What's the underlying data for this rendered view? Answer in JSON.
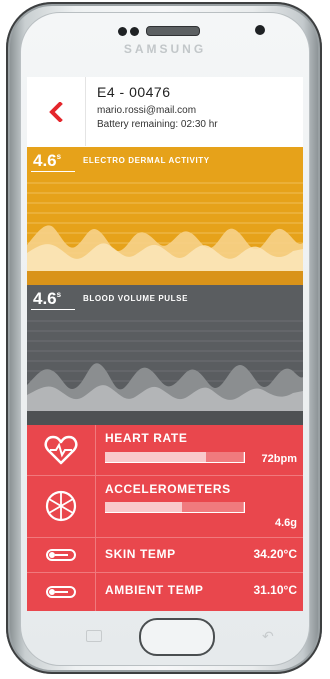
{
  "phone": {
    "brand": "SAMSUNG"
  },
  "header": {
    "device_id": "E4 - 00476",
    "email": "mario.rossi@mail.com",
    "battery": "Battery remaining: 02:30 hr"
  },
  "eda": {
    "value": "4.6",
    "unit": "s",
    "label": "ELECTRO DERMAL ACTIVITY",
    "color": "#e6a21a"
  },
  "bvp": {
    "value": "4.6",
    "unit": "s",
    "label": "BLOOD VOLUME PULSE",
    "color": "#5a5d60"
  },
  "metrics": {
    "heart_rate": {
      "title": "HEART RATE",
      "value": "72bpm",
      "level": 0.72
    },
    "accelerometers": {
      "title": "ACCELEROMETERS",
      "value": "4.6g",
      "level": 0.55
    },
    "skin_temp": {
      "title": "SKIN TEMP",
      "value": "34.20°C"
    },
    "ambient_temp": {
      "title": "AMBIENT TEMP",
      "value": "31.10°C"
    },
    "color": "#e9474d"
  }
}
